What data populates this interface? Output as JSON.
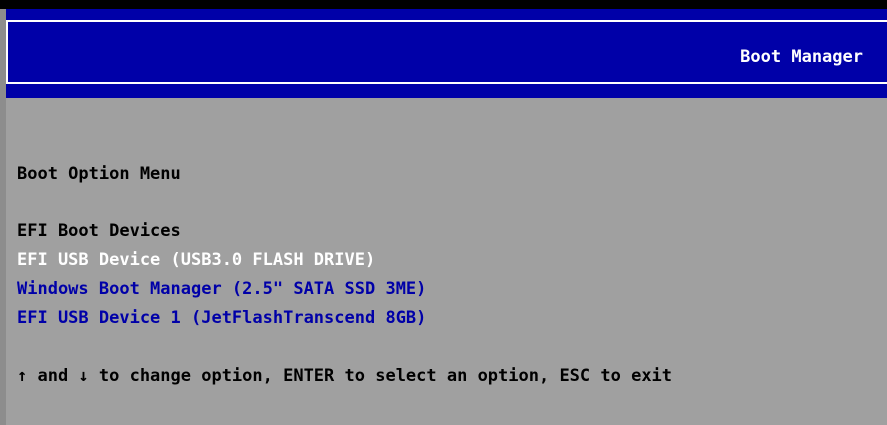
{
  "header": {
    "title": "Boot Manager"
  },
  "menu": {
    "title": "Boot Option Menu",
    "section_label": "EFI Boot Devices",
    "options": [
      {
        "label": "EFI USB Device (USB3.0  FLASH DRIVE)",
        "selected": true
      },
      {
        "label": "Windows Boot Manager (2.5\" SATA SSD 3ME)",
        "selected": false
      },
      {
        "label": "EFI USB Device 1 (JetFlashTranscend 8GB)",
        "selected": false
      }
    ]
  },
  "footer": {
    "help": "↑ and ↓ to change option, ENTER to select an option, ESC to exit"
  },
  "colors": {
    "background": "#a0a0a0",
    "header_bg": "#0000a8",
    "selected_text": "#ffffff",
    "option_text": "#0000a8",
    "static_text": "#000000"
  }
}
